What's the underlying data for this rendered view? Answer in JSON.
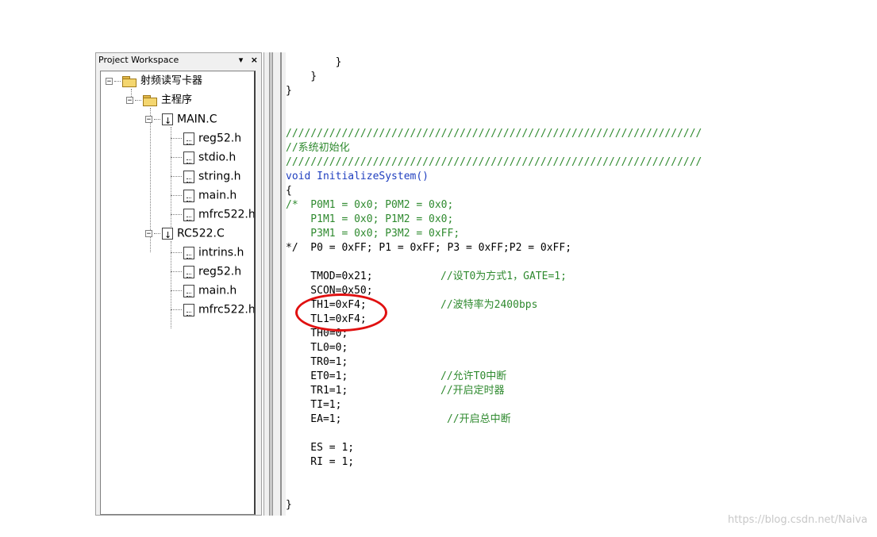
{
  "workspace": {
    "title": "Project Workspace",
    "pin_glyph": "▾",
    "close_glyph": "×",
    "tree": {
      "root": "射频读写卡器",
      "group": "主程序",
      "files": [
        {
          "name": "MAIN.C",
          "children": [
            "reg52.h",
            "stdio.h",
            "string.h",
            "main.h",
            "mfrc522.h"
          ]
        },
        {
          "name": "RC522.C",
          "children": [
            "intrins.h",
            "reg52.h",
            "main.h",
            "mfrc522.h"
          ]
        }
      ]
    }
  },
  "editor": {
    "lines": [
      "        }",
      "    }",
      "}",
      "",
      "",
      "///////////////////////////////////////////////////////////////////",
      "//系统初始化",
      "///////////////////////////////////////////////////////////////////",
      "void InitializeSystem()",
      "{",
      "/*  P0M1 = 0x0; P0M2 = 0x0;",
      "    P1M1 = 0x0; P1M2 = 0x0;",
      "    P3M1 = 0x0; P3M2 = 0xFF;",
      "*/  P0 = 0xFF; P1 = 0xFF; P3 = 0xFF;P2 = 0xFF;",
      "",
      "    TMOD=0x21;",
      "    SCON=0x50;",
      "    TH1=0xF4;",
      "    TL1=0xF4;",
      "    TH0=0;",
      "    TL0=0;",
      "    TR0=1;",
      "    ET0=1;",
      "    TR1=1;",
      "    TI=1;",
      "    EA=1;",
      "",
      "    ES = 1;",
      "    RI = 1;",
      "",
      "",
      "",
      "}"
    ],
    "comments": {
      "tmod": "//设T0为方式1，GATE=1;",
      "th1": "//波特率为2400bps",
      "et0": "//允许T0中断",
      "tr1": "//开启定时器",
      "ea": "//开启总中断"
    }
  },
  "watermark": "https://blog.csdn.net/Naiva",
  "colors": {
    "comment": "#2f8a2f",
    "keyword": "#1f3fbf",
    "highlight_circle": "#e01010"
  }
}
